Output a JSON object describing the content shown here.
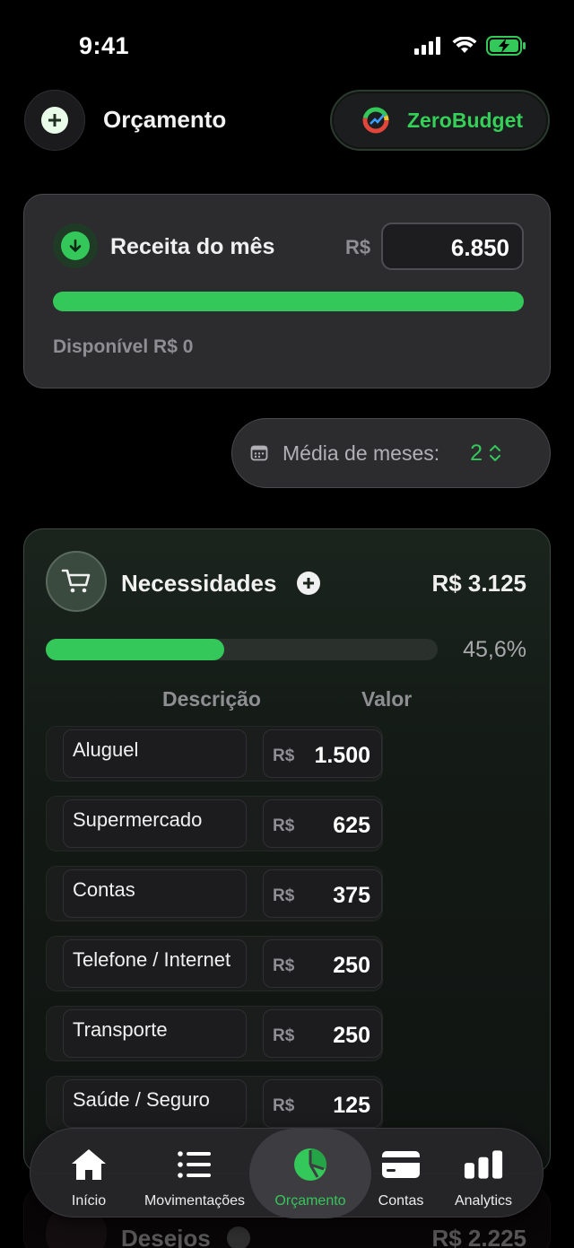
{
  "status": {
    "time": "9:41"
  },
  "header": {
    "title": "Orçamento",
    "brand": "ZeroBudget"
  },
  "income": {
    "title": "Receita do mês",
    "currency": "R$",
    "value": "6.850",
    "progress": 1.0,
    "available": "Disponível R$ 0"
  },
  "months": {
    "label": "Média de meses:",
    "value": "2"
  },
  "needs": {
    "title": "Necessidades",
    "total": "R$ 3.125",
    "percent_label": "45,6%",
    "progress": 0.456,
    "col_description": "Descrição",
    "col_value": "Valor",
    "rows": [
      {
        "description": "Aluguel",
        "currency": "R$",
        "amount": "1.500"
      },
      {
        "description": "Supermercado",
        "currency": "R$",
        "amount": "625"
      },
      {
        "description": "Contas",
        "currency": "R$",
        "amount": "375"
      },
      {
        "description": "Telefone / Internet",
        "currency": "R$",
        "amount": "250"
      },
      {
        "description": "Transporte",
        "currency": "R$",
        "amount": "250"
      },
      {
        "description": "Saúde / Seguro",
        "currency": "R$",
        "amount": "125"
      }
    ]
  },
  "wants": {
    "title": "Desejos",
    "total": "R$ 2.225"
  },
  "tabs": [
    {
      "label": "Início",
      "icon": "home-icon",
      "active": false
    },
    {
      "label": "Movimentações",
      "icon": "list-icon",
      "active": false
    },
    {
      "label": "Orçamento",
      "icon": "pie-chart-icon",
      "active": true
    },
    {
      "label": "Contas",
      "icon": "card-icon",
      "active": false
    },
    {
      "label": "Analytics",
      "icon": "bar-chart-icon",
      "active": false
    }
  ],
  "colors": {
    "accent": "#34c759",
    "brand": "#34d058",
    "background": "#000000"
  }
}
